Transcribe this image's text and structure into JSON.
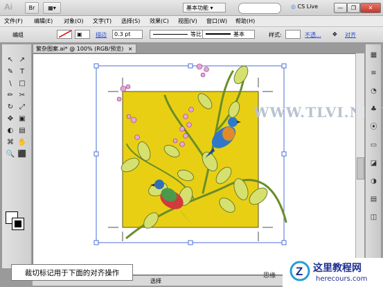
{
  "app": {
    "logo": "Ai"
  },
  "topbar": {
    "buttons": [
      "Br",
      "▦▾"
    ],
    "workspace": "基本功能",
    "cs_live": "CS Live",
    "window_buttons": [
      "—",
      "❐",
      "✕"
    ]
  },
  "menu": [
    "文件(F)",
    "编辑(E)",
    "对象(O)",
    "文字(T)",
    "选择(S)",
    "效果(C)",
    "视图(V)",
    "窗口(W)",
    "帮助(H)"
  ],
  "control": {
    "mode_label": "编组",
    "stroke_label": "描边",
    "stroke_value": "0.3 pt",
    "profile_label": "等比",
    "brush_label": "基本",
    "style_label": "样式:",
    "opacity_label": "不透...",
    "align_label": "对齐"
  },
  "document": {
    "tab_title": "繁杂图案.ai* @ 100% (RGB/预览)",
    "close": "×"
  },
  "watermark": "WWW.TLVI.NET",
  "caption": "裁切标记用于下面的对齐操作",
  "status": {
    "selection": "选择",
    "partial": "思缘"
  },
  "brand": {
    "cn": "这里教程网",
    "en": "herecours.com"
  },
  "tools": [
    "↖",
    "↗",
    "✎",
    "T",
    "\\",
    "□",
    "✏",
    "✂",
    "↻",
    "⤢",
    "✥",
    "▣",
    "◐",
    "▤",
    "⌘",
    "✋",
    "🔍",
    "⬛"
  ],
  "dock_icons": [
    "▦",
    "≡",
    "◔",
    "♣",
    "⦿",
    "▭",
    "◪",
    "◑",
    "▤",
    "◫"
  ]
}
